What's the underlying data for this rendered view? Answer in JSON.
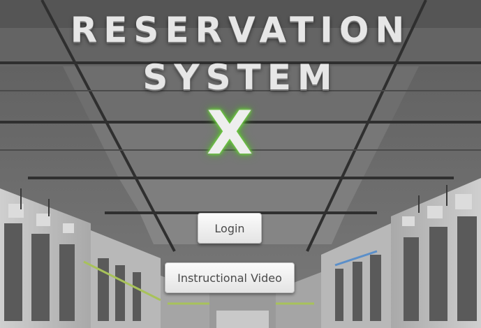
{
  "header": {
    "title_line1": "RESERVATION",
    "title_line2": "SYSTEM",
    "logo_glyph": "X"
  },
  "actions": {
    "login_label": "Login",
    "video_label": "Instructional Video"
  },
  "colors": {
    "logo_glow": "#5fbf37",
    "button_bg": "#f2f2f2",
    "button_text": "#4a4a4a",
    "ceiling": "#6b6b6b"
  }
}
